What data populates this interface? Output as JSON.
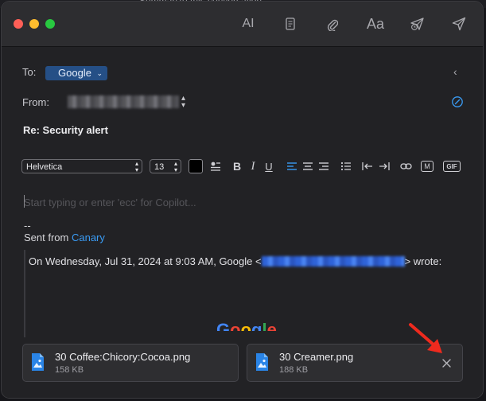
{
  "background": {
    "text": "Summarize this conversation"
  },
  "header": {
    "to_label": "To:",
    "to_recipient": "Google",
    "from_label": "From:",
    "subject": "Re: Security alert"
  },
  "toolbar": {
    "ai_label": "AI",
    "font_label": "Aa",
    "icons": [
      "ai-icon",
      "notes-icon",
      "paperclip-icon",
      "font-icon",
      "schedule-send-icon",
      "send-icon"
    ]
  },
  "format_bar": {
    "font_family": "Helvetica",
    "font_size": "13",
    "bold": "B",
    "italic": "I",
    "underline": "U",
    "markdown": "M",
    "gif": "GIF"
  },
  "body": {
    "placeholder": "Start typing or enter 'ecc' for Copilot...",
    "signature_dash": "--",
    "signature_prefix": "Sent from ",
    "signature_link": "Canary",
    "quote_prefix": "On Wednesday, Jul 31, 2024 at 9:03 AM, Google <",
    "quote_suffix": "> wrote:",
    "logo_text": "Google"
  },
  "attachments": [
    {
      "name": "30 Coffee:Chicory:Cocoa.png",
      "size": "158 KB"
    },
    {
      "name": "30 Creamer.png",
      "size": "188 KB"
    }
  ],
  "colors": {
    "accent": "#3a9cf5",
    "pill": "#254f86",
    "annotation_arrow": "#ee2a1e"
  }
}
